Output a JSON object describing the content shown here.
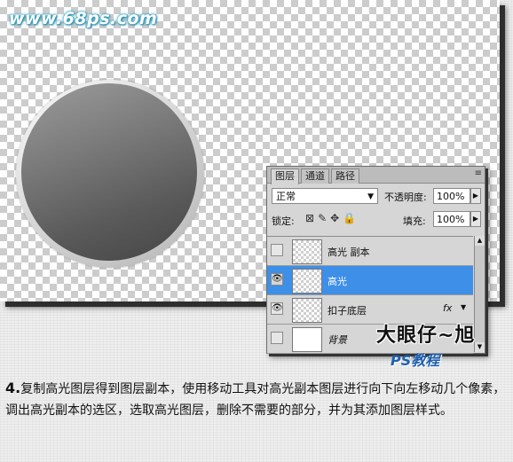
{
  "watermark": "www.68ps.com",
  "panel": {
    "tabs": [
      "图层",
      "通道",
      "路径"
    ],
    "menu_icon": "≡",
    "blend_mode": "正常",
    "opacity_label": "不透明度:",
    "opacity_value": "100%",
    "lock_label": "锁定:",
    "fill_label": "填充:",
    "fill_value": "100%",
    "layers": [
      {
        "name": "高光 副本",
        "visible": false,
        "selected": false
      },
      {
        "name": "高光",
        "visible": true,
        "selected": true
      },
      {
        "name": "扣子底层",
        "visible": true,
        "selected": false,
        "fx": "fx"
      },
      {
        "name": "背景",
        "visible": false,
        "selected": false
      }
    ]
  },
  "author": "大眼仔~旭",
  "author_sub": "PS教程",
  "caption": {
    "step": "4.",
    "text": "复制高光图层得到图层副本，使用移动工具对高光副本图层进行向下向左移动几个像素，调出高光副本的选区，选取高光图层，删除不需要的部分，并为其添加图层样式。"
  },
  "colors": {
    "selection": "#3d8fe8",
    "watermark_glow": "#2aa0c8",
    "author_sub": "#1e5fb0"
  }
}
